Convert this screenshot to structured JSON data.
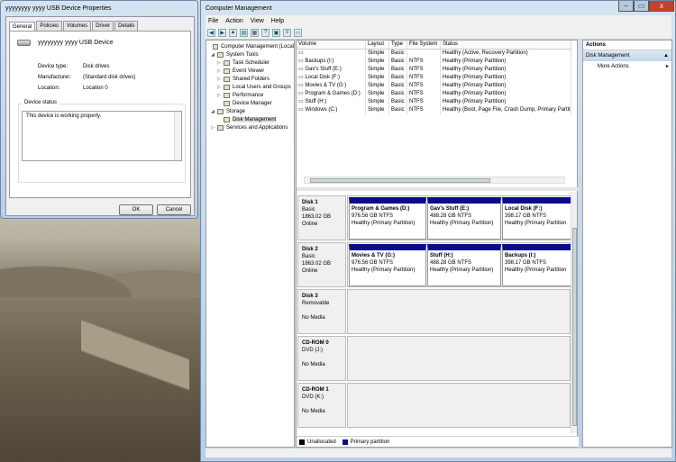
{
  "props": {
    "title": "yyyyyyyy yyyy USB Device Properties",
    "tabs": [
      "General",
      "Policies",
      "Volumes",
      "Driver",
      "Details"
    ],
    "device_name": "yyyyyyyy yyyy USB Device",
    "device_type_label": "Device type:",
    "device_type": "Disk drives",
    "manufacturer_label": "Manufacturer:",
    "manufacturer": "(Standard disk drives)",
    "location_label": "Location:",
    "location": "Location 0",
    "status_label": "Device status",
    "status_text": "This device is working properly.",
    "ok": "OK",
    "cancel": "Cancel"
  },
  "cm": {
    "title": "Computer Management",
    "controls": {
      "minimize": "–",
      "maximize": "▭",
      "close": "x"
    },
    "menu": [
      "File",
      "Action",
      "View",
      "Help"
    ],
    "tree": [
      {
        "label": "Computer Management (Local",
        "indent": 0,
        "ex": ""
      },
      {
        "label": "System Tools",
        "indent": 1,
        "ex": "◢"
      },
      {
        "label": "Task Scheduler",
        "indent": 2,
        "ex": "▷"
      },
      {
        "label": "Event Viewer",
        "indent": 2,
        "ex": "▷"
      },
      {
        "label": "Shared Folders",
        "indent": 2,
        "ex": "▷"
      },
      {
        "label": "Local Users and Groups",
        "indent": 2,
        "ex": "▷"
      },
      {
        "label": "Performance",
        "indent": 2,
        "ex": "▷"
      },
      {
        "label": "Device Manager",
        "indent": 2,
        "ex": ""
      },
      {
        "label": "Storage",
        "indent": 1,
        "ex": "◢"
      },
      {
        "label": "Disk Management",
        "indent": 2,
        "ex": "",
        "sel": true
      },
      {
        "label": "Services and Applications",
        "indent": 1,
        "ex": "▷"
      }
    ],
    "vol_headers": [
      "Volume",
      "Layout",
      "Type",
      "File System",
      "Status"
    ],
    "volumes": [
      [
        "",
        "Simple",
        "Basic",
        "",
        "Healthy (Active, Recovery Partition)"
      ],
      [
        "Backups (I:)",
        "Simple",
        "Basic",
        "NTFS",
        "Healthy (Primary Partition)"
      ],
      [
        "Gav's Stuff (E:)",
        "Simple",
        "Basic",
        "NTFS",
        "Healthy (Primary Partition)"
      ],
      [
        "Local Disk (F:)",
        "Simple",
        "Basic",
        "NTFS",
        "Healthy (Primary Partition)"
      ],
      [
        "Movies & TV (G:)",
        "Simple",
        "Basic",
        "NTFS",
        "Healthy (Primary Partition)"
      ],
      [
        "Program & Games (D:)",
        "Simple",
        "Basic",
        "NTFS",
        "Healthy (Primary Partition)"
      ],
      [
        "Stuff (H:)",
        "Simple",
        "Basic",
        "NTFS",
        "Healthy (Primary Partition)"
      ],
      [
        "Windows (C:)",
        "Simple",
        "Basic",
        "NTFS",
        "Healthy (Boot, Page File, Crash Dump, Primary Partitio"
      ]
    ],
    "disks": [
      {
        "name": "Disk 1",
        "l2": "Basic",
        "l3": "1863.02 GB",
        "l4": "Online",
        "parts": [
          {
            "name": "Program & Games  (D:)",
            "size": "976.56 GB NTFS",
            "st": "Healthy (Primary Partition)"
          },
          {
            "name": "Gav's Stuff  (E:)",
            "size": "488.28 GB NTFS",
            "st": "Healthy (Primary Partition)"
          },
          {
            "name": "Local Disk  (F:)",
            "size": "398.17 GB NTFS",
            "st": "Healthy (Primary Partition"
          }
        ]
      },
      {
        "name": "Disk 2",
        "l2": "Basic",
        "l3": "1863.02 GB",
        "l4": "Online",
        "parts": [
          {
            "name": "Movies & TV  (G:)",
            "size": "976.56 GB NTFS",
            "st": "Healthy (Primary Partition)"
          },
          {
            "name": "Stuff  (H:)",
            "size": "488.28 GB NTFS",
            "st": "Healthy (Primary Partition)"
          },
          {
            "name": "Backups  (I:)",
            "size": "398.17 GB NTFS",
            "st": "Healthy (Primary Partition"
          }
        ]
      },
      {
        "name": "Disk 3",
        "l2": "Removable",
        "l3": "",
        "l4": "No Media",
        "parts": []
      },
      {
        "name": "CD-ROM 0",
        "l2": "DVD (J:)",
        "l3": "",
        "l4": "No Media",
        "parts": []
      },
      {
        "name": "CD-ROM 1",
        "l2": "DVD (K:)",
        "l3": "",
        "l4": "No Media",
        "parts": []
      }
    ],
    "legend": {
      "unallocated": "Unallocated",
      "primary": "Primary partition"
    },
    "actions": {
      "header": "Actions",
      "section": "Disk Management",
      "more": "More Actions"
    }
  },
  "colors": {
    "primary": "#0b0b8e",
    "unallocated": "#000000",
    "close": "#c7402f"
  }
}
